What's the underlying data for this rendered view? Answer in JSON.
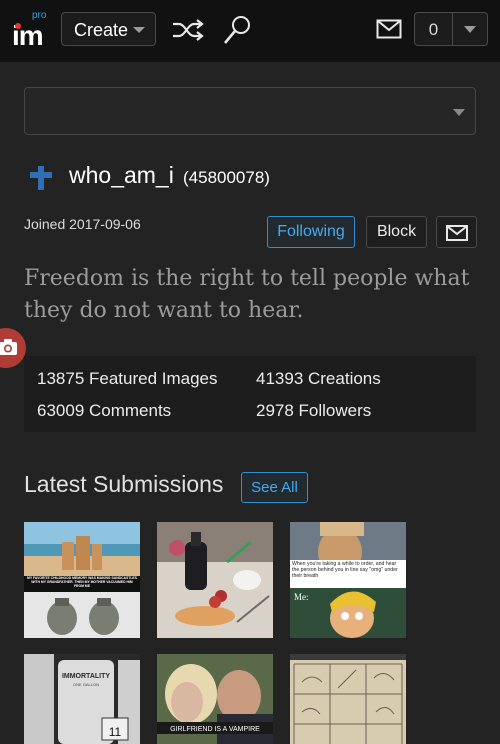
{
  "header": {
    "logo_pro": "pro",
    "logo_text": "im",
    "create_label": "Create",
    "notification_count": "0"
  },
  "profile": {
    "username": "who_am_i",
    "user_id": "(45800078)",
    "joined": "Joined 2017-09-06",
    "following_label": "Following",
    "block_label": "Block",
    "quote": "Freedom is the right to tell people what they do not want to hear."
  },
  "stats": {
    "featured": "13875 Featured Images",
    "creations": "41393 Creations",
    "comments": "63009 Comments",
    "followers": "2978 Followers"
  },
  "latest": {
    "title": "Latest Submissions",
    "see_all": "See All",
    "thumb1_caption": "MY FAVORITE CHILDHOOD MEMORY WAS MAKING SANDCASTLES WITH MY GRANDFATHER. THEN MY MOTHER VACUUMED HIM FROM ME",
    "thumb3_text": "When you're taking a while to order, and hear the person behind you in line say \"omg\" under their breath",
    "thumb3_me": "Me:",
    "thumb4_label": "IMMORTALITY",
    "thumb4_sub": "ONE GALLON",
    "thumb4_price": "11",
    "thumb5_caption": "GIRLFRIEND IS A VAMPIRE"
  },
  "colors": {
    "accent_blue": "#2f8fd0",
    "camera_red": "#b03c36",
    "background": "#232323",
    "topbar": "#111111"
  },
  "icons": [
    "shuffle-icon",
    "search-icon",
    "mail-icon",
    "cross-icon",
    "camera-icon",
    "chevron-down-icon"
  ]
}
